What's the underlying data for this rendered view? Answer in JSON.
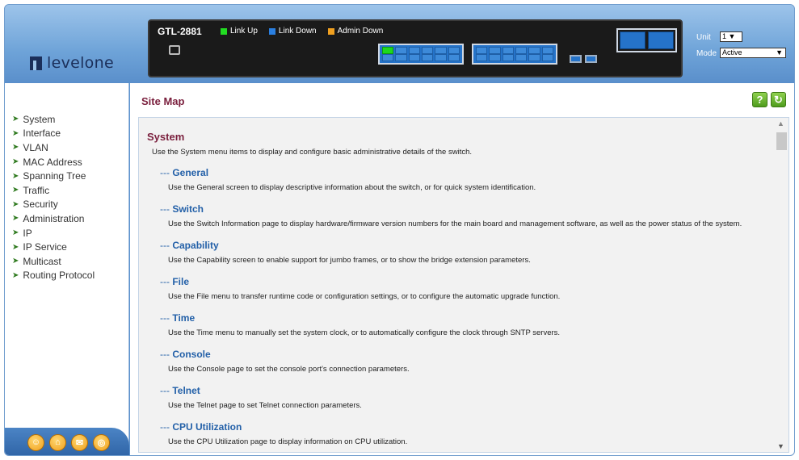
{
  "brand": {
    "logo_text": "levelone"
  },
  "device": {
    "model": "GTL-2881",
    "legend": [
      {
        "label": "Link Up",
        "color": "#22dd22"
      },
      {
        "label": "Link Down",
        "color": "#2a7fe0"
      },
      {
        "label": "Admin Down",
        "color": "#f0a020"
      }
    ],
    "unit_label": "Unit",
    "unit_value": "1",
    "mode_label": "Mode",
    "mode_value": "Active"
  },
  "sidebar": {
    "items": [
      {
        "label": "System"
      },
      {
        "label": "Interface"
      },
      {
        "label": "VLAN"
      },
      {
        "label": "MAC Address"
      },
      {
        "label": "Spanning Tree"
      },
      {
        "label": "Traffic"
      },
      {
        "label": "Security"
      },
      {
        "label": "Administration"
      },
      {
        "label": "IP"
      },
      {
        "label": "IP Service"
      },
      {
        "label": "Multicast"
      },
      {
        "label": "Routing Protocol"
      }
    ]
  },
  "content": {
    "title": "Site Map",
    "section": {
      "title": "System",
      "desc": "Use the System menu items to display and configure basic administrative details of the switch."
    },
    "entries": [
      {
        "prefix": "---",
        "title": "General",
        "desc": "Use the General screen to display descriptive information about the switch, or for quick system identification."
      },
      {
        "prefix": "---",
        "title": "Switch",
        "desc": "Use the Switch Information page to display hardware/firmware version numbers for the main board and management software, as well as the power status of the system."
      },
      {
        "prefix": "---",
        "title": "Capability",
        "desc": "Use the Capability screen to enable support for jumbo frames, or to show the bridge extension parameters."
      },
      {
        "prefix": "---",
        "title": "File",
        "desc": "Use the File menu to transfer runtime code or configuration settings, or to configure the automatic upgrade function."
      },
      {
        "prefix": "---",
        "title": "Time",
        "desc": "Use the Time menu to manually set the system clock, or to automatically configure the clock through SNTP servers."
      },
      {
        "prefix": "---",
        "title": "Console",
        "desc": "Use the Console page to set the console port's connection parameters."
      },
      {
        "prefix": "---",
        "title": "Telnet",
        "desc": "Use the Telnet page to set Telnet connection parameters."
      },
      {
        "prefix": "---",
        "title": "CPU Utilization",
        "desc": "Use the CPU Utilization page to display information on CPU utilization."
      }
    ]
  }
}
